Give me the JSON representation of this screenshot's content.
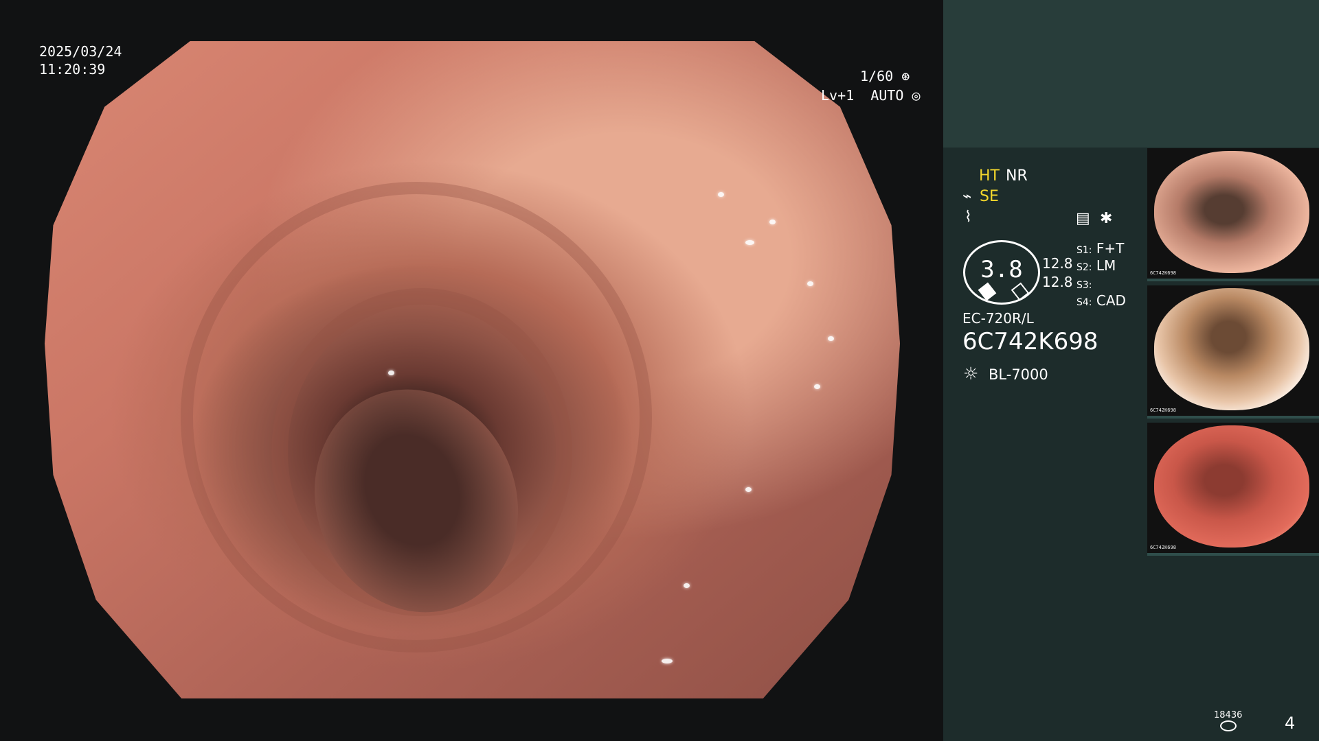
{
  "overlay": {
    "date": "2025/03/24",
    "time": "11:20:39",
    "shutter_text": "1/60",
    "shutter_icon": "aperture-icon",
    "level_text": "Lv+1",
    "auto_text": "AUTO",
    "auto_icon": "auto-iris-icon"
  },
  "side_panel": {
    "labels": {
      "ht": "HT",
      "nr": "NR",
      "se": "SE",
      "freeze_symbol": "⌇",
      "memory_symbol": "✱"
    },
    "gauge": {
      "value": "3.8",
      "upper": "12.8",
      "lower": "12.8"
    },
    "settings": {
      "s1_key": "S1:",
      "s1_value": "F+T",
      "s2_key": "S2:",
      "s2_value": "LM",
      "s3_key": "S3:",
      "s3_value": "",
      "s4_key": "S4:",
      "s4_value": "CAD"
    },
    "scope_model": "EC-720R/L",
    "scope_serial": "6C742K698",
    "light_source": "BL-7000",
    "storage_count": "18436",
    "page_number": "4"
  },
  "thumbnails": [
    {
      "label": "6C742K698"
    },
    {
      "label": "6C742K698"
    },
    {
      "label": "6C742K698"
    }
  ],
  "colors": {
    "panel": "#1d2c2b",
    "top_panel": "#283d3a",
    "accent_yellow": "#f5d82c"
  }
}
